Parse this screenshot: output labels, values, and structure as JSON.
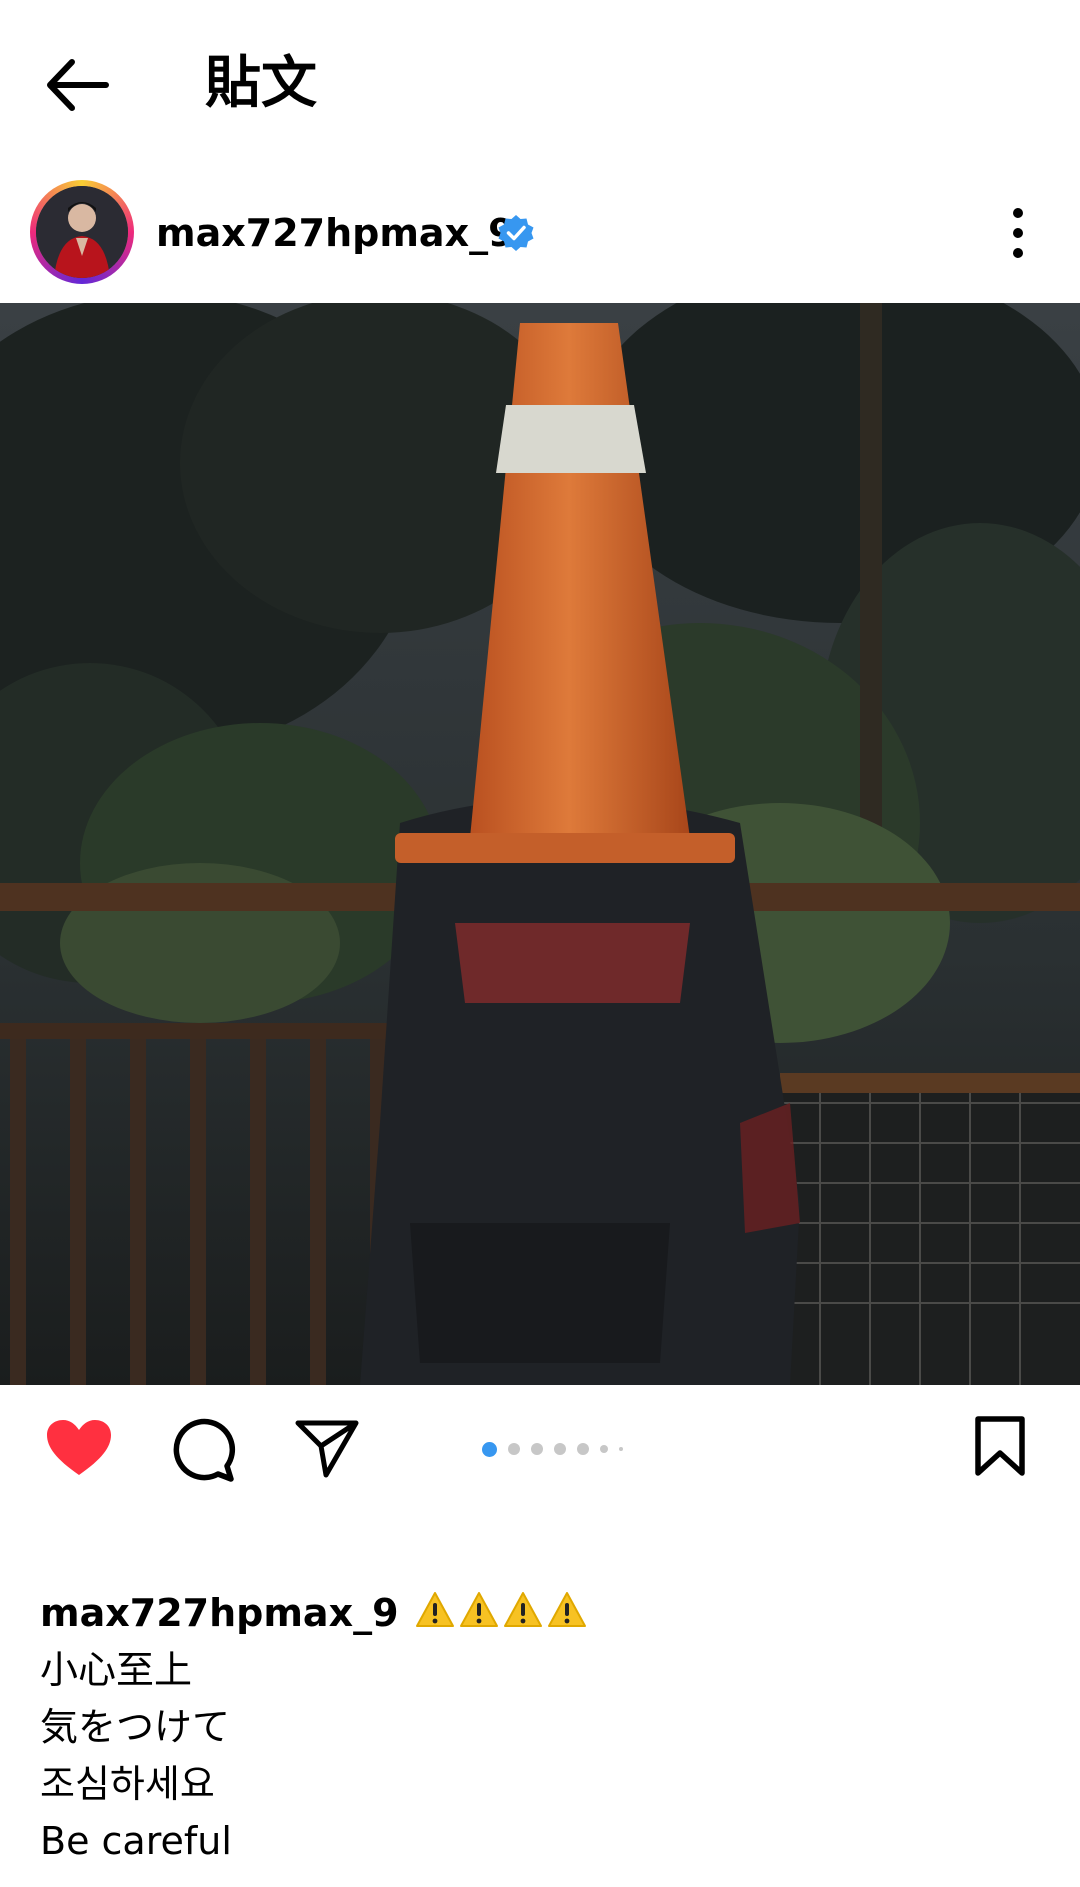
{
  "header": {
    "title": "貼文"
  },
  "post": {
    "username": "max727hpmax_9",
    "verified": true,
    "image": {
      "description_icon": "photo-of-person-wearing-traffic-cone"
    },
    "carousel": {
      "total": 7,
      "current": 1
    },
    "liked": true
  },
  "caption": {
    "username": "max727hpmax_9",
    "emoji": [
      "⚠️",
      "⚠️",
      "⚠️",
      "⚠️"
    ],
    "lines": [
      "小心至上",
      "気をつけて",
      "조심하세요",
      "Be careful"
    ]
  },
  "colors": {
    "like_red": "#ff3040",
    "verified_blue": "#3797f0",
    "active_dot": "#3797f0",
    "cone_orange": "#d46a2c"
  }
}
